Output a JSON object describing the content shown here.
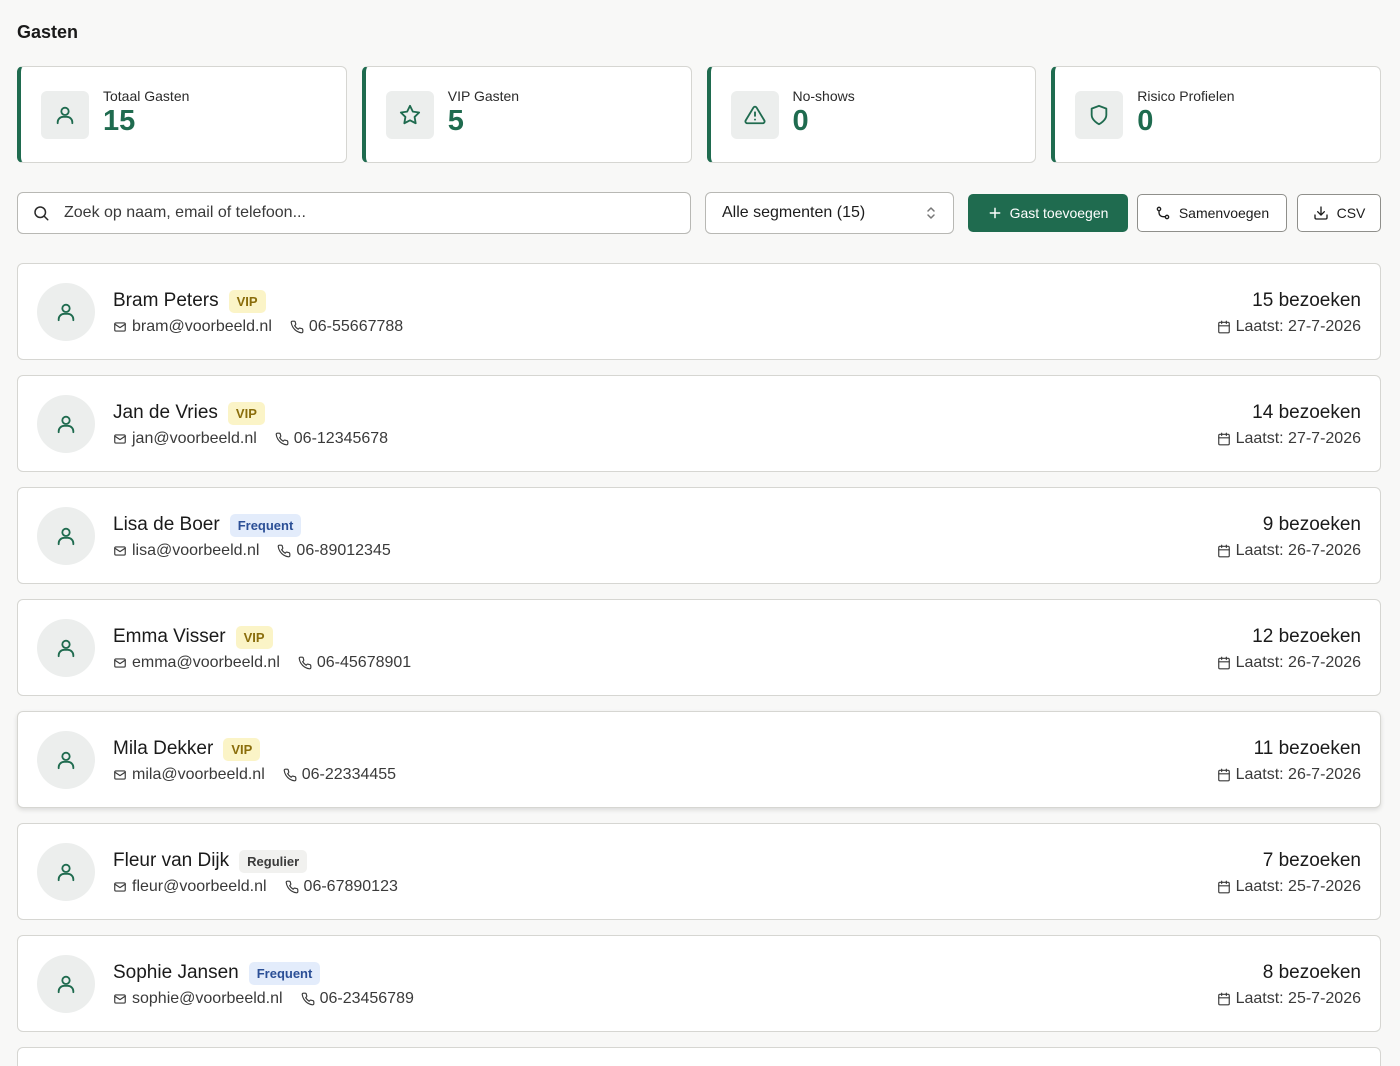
{
  "page": {
    "title": "Gasten"
  },
  "colors": {
    "accent": "#1f6b4f",
    "vip_bg": "#fbf4c7",
    "vip_text": "#8a6d0b",
    "frequent_bg": "#e3ecfb",
    "frequent_text": "#2b4f96",
    "regulier_bg": "#f1f1ef",
    "regulier_text": "#3b3b3b"
  },
  "stats": [
    {
      "label": "Totaal Gasten",
      "value": "15",
      "icon": "user-icon"
    },
    {
      "label": "VIP Gasten",
      "value": "5",
      "icon": "star-icon"
    },
    {
      "label": "No-shows",
      "value": "0",
      "icon": "warning-icon"
    },
    {
      "label": "Risico Profielen",
      "value": "0",
      "icon": "shield-icon"
    }
  ],
  "toolbar": {
    "search_placeholder": "Zoek op naam, email of telefoon...",
    "segment_selected": "Alle segmenten (15)",
    "add_label": "Gast toevoegen",
    "merge_label": "Samenvoegen",
    "csv_label": "CSV"
  },
  "guests": [
    {
      "name": "Bram Peters",
      "badge": "VIP",
      "email": "bram@voorbeeld.nl",
      "phone": "06-55667788",
      "visits": "15 bezoeken",
      "last": "Laatst: 27-7-2026"
    },
    {
      "name": "Jan de Vries",
      "badge": "VIP",
      "email": "jan@voorbeeld.nl",
      "phone": "06-12345678",
      "visits": "14 bezoeken",
      "last": "Laatst: 27-7-2026"
    },
    {
      "name": "Lisa de Boer",
      "badge": "Frequent",
      "email": "lisa@voorbeeld.nl",
      "phone": "06-89012345",
      "visits": "9 bezoeken",
      "last": "Laatst: 26-7-2026"
    },
    {
      "name": "Emma Visser",
      "badge": "VIP",
      "email": "emma@voorbeeld.nl",
      "phone": "06-45678901",
      "visits": "12 bezoeken",
      "last": "Laatst: 26-7-2026"
    },
    {
      "name": "Mila Dekker",
      "badge": "VIP",
      "email": "mila@voorbeeld.nl",
      "phone": "06-22334455",
      "visits": "11 bezoeken",
      "last": "Laatst: 26-7-2026"
    },
    {
      "name": "Fleur van Dijk",
      "badge": "Regulier",
      "email": "fleur@voorbeeld.nl",
      "phone": "06-67890123",
      "visits": "7 bezoeken",
      "last": "Laatst: 25-7-2026"
    },
    {
      "name": "Sophie Jansen",
      "badge": "Frequent",
      "email": "sophie@voorbeeld.nl",
      "phone": "06-23456789",
      "visits": "8 bezoeken",
      "last": "Laatst: 25-7-2026"
    }
  ]
}
